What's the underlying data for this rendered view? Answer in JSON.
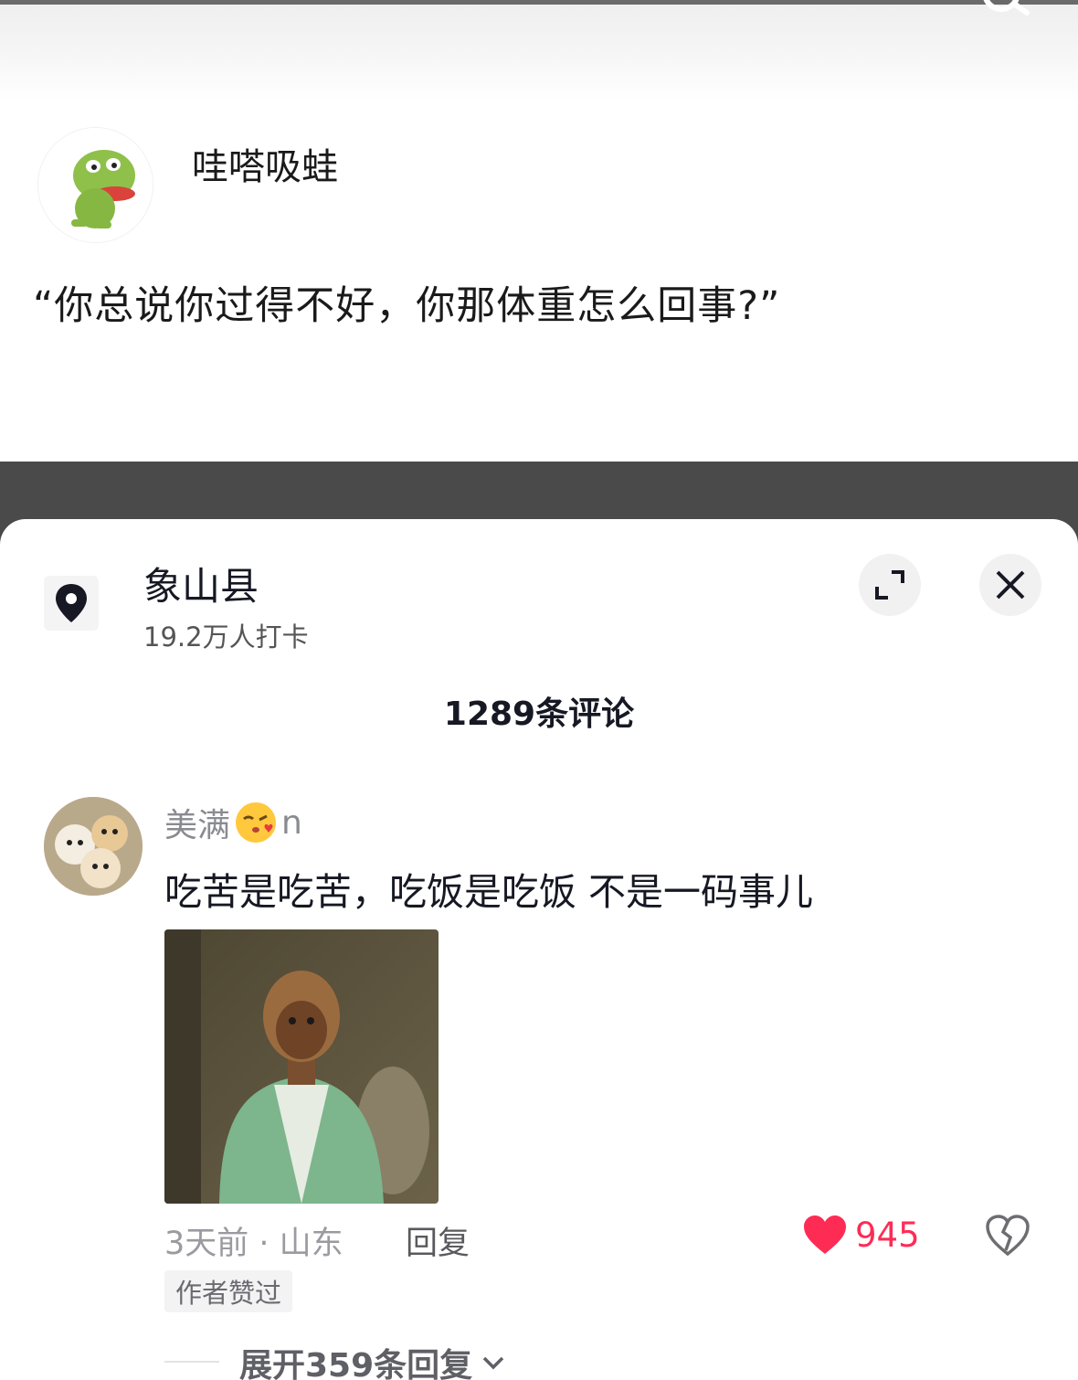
{
  "post": {
    "author_name": "哇嗒吸蛙",
    "text": "“你总说你过得不好，你那体重怎么回事?”"
  },
  "location": {
    "name": "象山县",
    "checkins": "19.2万人打卡"
  },
  "comments_header": {
    "count_label": "1289条评论"
  },
  "comment": {
    "username_prefix": "美满",
    "username_suffix": "n",
    "text": "吃苦是吃苦，吃饭是吃饭 不是一码事儿",
    "meta": "3天前 · 山东",
    "reply_label": "回复",
    "like_count": "945",
    "author_liked_badge": "作者赞过",
    "expand_replies_label": "展开359条回复"
  },
  "colors": {
    "like_red": "#fe2c55",
    "dark_band": "#4a4a4a"
  },
  "icons": {
    "location": "location-pin-icon",
    "expand": "expand-icon",
    "close": "close-icon",
    "like": "heart-icon",
    "dislike": "broken-heart-icon",
    "chevron": "chevron-down-icon",
    "search": "search-icon"
  }
}
